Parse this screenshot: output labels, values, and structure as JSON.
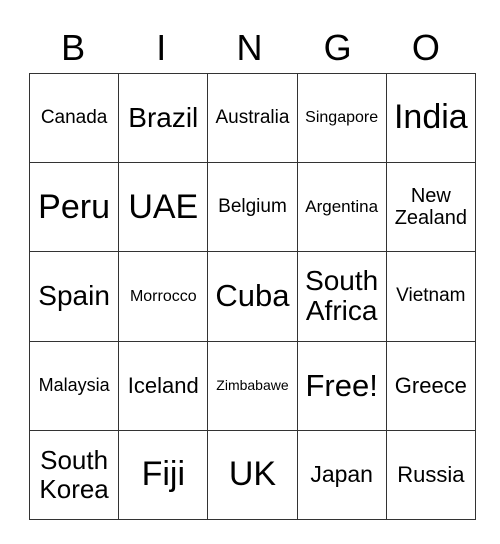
{
  "header": {
    "letters": [
      "B",
      "I",
      "N",
      "G",
      "O"
    ]
  },
  "grid": {
    "rows": [
      [
        {
          "text": "Canada",
          "size": 19
        },
        {
          "text": "Brazil",
          "size": 28
        },
        {
          "text": "Australia",
          "size": 19
        },
        {
          "text": "Singapore",
          "size": 16
        },
        {
          "text": "India",
          "size": 34
        }
      ],
      [
        {
          "text": "Peru",
          "size": 34
        },
        {
          "text": "UAE",
          "size": 34
        },
        {
          "text": "Belgium",
          "size": 19
        },
        {
          "text": "Argentina",
          "size": 17
        },
        {
          "text": "New Zealand",
          "size": 20
        }
      ],
      [
        {
          "text": "Spain",
          "size": 28
        },
        {
          "text": "Morrocco",
          "size": 16
        },
        {
          "text": "Cuba",
          "size": 31
        },
        {
          "text": "South Africa",
          "size": 28
        },
        {
          "text": "Vietnam",
          "size": 19
        }
      ],
      [
        {
          "text": "Malaysia",
          "size": 18
        },
        {
          "text": "Iceland",
          "size": 22
        },
        {
          "text": "Zimbabawe",
          "size": 14
        },
        {
          "text": "Free!",
          "size": 31
        },
        {
          "text": "Greece",
          "size": 22
        }
      ],
      [
        {
          "text": "South Korea",
          "size": 26
        },
        {
          "text": "Fiji",
          "size": 34
        },
        {
          "text": "UK",
          "size": 34
        },
        {
          "text": "Japan",
          "size": 23
        },
        {
          "text": "Russia",
          "size": 22
        }
      ]
    ]
  }
}
